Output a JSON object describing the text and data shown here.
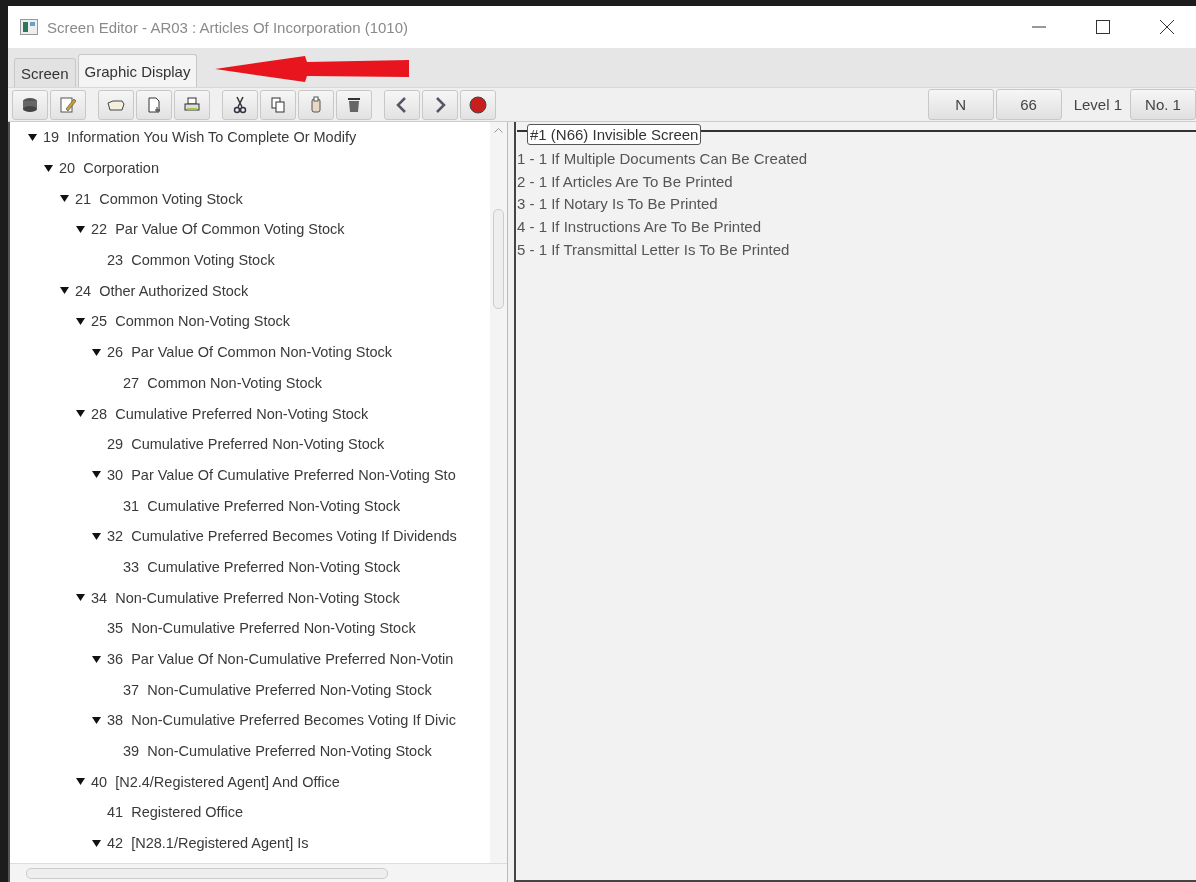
{
  "window": {
    "title": "Screen Editor - AR03 : Articles Of Incorporation (1010)"
  },
  "tabs": [
    {
      "label": "Screen",
      "selected": false
    },
    {
      "label": "Graphic Display",
      "selected": true
    }
  ],
  "toolbar_right": [
    {
      "kind": "button",
      "label": "N"
    },
    {
      "kind": "button",
      "label": "66"
    },
    {
      "kind": "label",
      "label": "Level 1"
    },
    {
      "kind": "button",
      "label": "No. 1"
    }
  ],
  "tree": [
    {
      "label": "19  Information You Wish To Complete Or Modify",
      "expanded": true,
      "children": [
        {
          "label": "20  Corporation",
          "expanded": true,
          "children": [
            {
              "label": "21  Common Voting Stock",
              "expanded": true,
              "children": [
                {
                  "label": "22  Par Value Of Common Voting Stock",
                  "expanded": true,
                  "children": [
                    {
                      "label": "23  Common Voting Stock"
                    }
                  ]
                }
              ]
            },
            {
              "label": "24  Other Authorized Stock",
              "expanded": true,
              "children": [
                {
                  "label": "25  Common Non-Voting Stock",
                  "expanded": true,
                  "children": [
                    {
                      "label": "26  Par Value Of Common Non-Voting Stock",
                      "expanded": true,
                      "children": [
                        {
                          "label": "27  Common Non-Voting Stock"
                        }
                      ]
                    }
                  ]
                },
                {
                  "label": "28  Cumulative Preferred Non-Voting Stock",
                  "expanded": true,
                  "children": [
                    {
                      "label": "29  Cumulative Preferred Non-Voting Stock"
                    },
                    {
                      "label": "30  Par Value Of Cumulative Preferred Non-Voting Sto",
                      "expanded": true,
                      "children": [
                        {
                          "label": "31  Cumulative Preferred Non-Voting Stock"
                        }
                      ]
                    },
                    {
                      "label": "32  Cumulative Preferred Becomes Voting If Dividends",
                      "expanded": true,
                      "children": [
                        {
                          "label": "33  Cumulative Preferred Non-Voting Stock"
                        }
                      ]
                    }
                  ]
                },
                {
                  "label": "34  Non-Cumulative Preferred Non-Voting Stock",
                  "expanded": true,
                  "children": [
                    {
                      "label": "35  Non-Cumulative Preferred Non-Voting Stock"
                    },
                    {
                      "label": "36  Par Value Of Non-Cumulative Preferred Non-Votin",
                      "expanded": true,
                      "children": [
                        {
                          "label": "37  Non-Cumulative Preferred Non-Voting Stock"
                        }
                      ]
                    },
                    {
                      "label": "38  Non-Cumulative Preferred Becomes Voting If Divic",
                      "expanded": true,
                      "children": [
                        {
                          "label": "39  Non-Cumulative Preferred Non-Voting Stock"
                        }
                      ]
                    }
                  ]
                },
                {
                  "label": "40  [N2.4/Registered Agent] And Office",
                  "expanded": true,
                  "children": [
                    {
                      "label": "41  Registered Office"
                    },
                    {
                      "label": "42  [N28.1/Registered Agent] Is",
                      "expanded": true
                    }
                  ]
                }
              ]
            }
          ]
        }
      ]
    }
  ],
  "display": {
    "title": "#1 (N66) Invisible Screen",
    "lines": [
      "1 - 1 If Multiple Documents Can Be Created",
      "2 - 1 If Articles Are To Be Printed",
      "3 - 1 If Notary Is To Be Printed",
      "4 - 1 If Instructions Are To Be Printed",
      "5 - 1 If Transmittal Letter Is To Be Printed"
    ]
  }
}
